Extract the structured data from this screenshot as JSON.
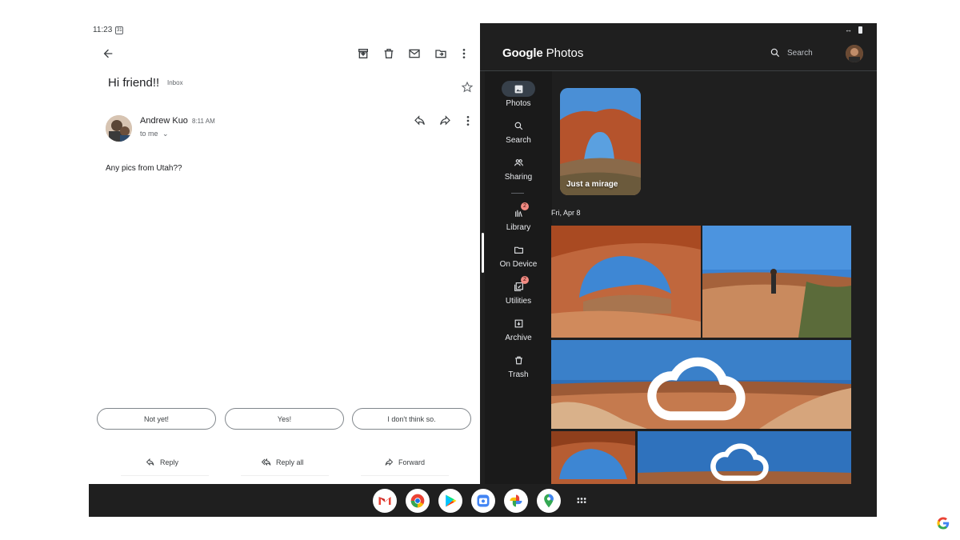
{
  "status_bar": {
    "time": "11:23"
  },
  "email": {
    "subject": "Hi friend!!",
    "label": "Inbox",
    "sender": "Andrew Kuo",
    "time": "8:11 AM",
    "recipient": "to me",
    "body": "Any pics from Utah??",
    "smart_replies": [
      "Not yet!",
      "Yes!",
      "I don't think so."
    ],
    "actions": {
      "reply": "Reply",
      "reply_all": "Reply all",
      "forward": "Forward"
    }
  },
  "photos": {
    "app_title": {
      "brand": "Google",
      "product": "Photos"
    },
    "search_label": "Search",
    "nav": [
      {
        "label": "Photos",
        "icon": "image-icon",
        "active": true
      },
      {
        "label": "Search",
        "icon": "search-icon"
      },
      {
        "label": "Sharing",
        "icon": "people-icon"
      },
      {
        "label": "Library",
        "icon": "library-icon",
        "badge": "2"
      },
      {
        "label": "On Device",
        "icon": "folder-icon"
      },
      {
        "label": "Utilities",
        "icon": "utilities-icon",
        "badge": "2"
      },
      {
        "label": "Archive",
        "icon": "archive-icon"
      },
      {
        "label": "Trash",
        "icon": "trash-icon"
      }
    ],
    "memory_title": "Just a mirage",
    "date_header": "Fri, Apr 8"
  },
  "taskbar": {
    "apps": [
      "gmail-icon",
      "chrome-icon",
      "play-store-icon",
      "camera-icon",
      "photos-icon",
      "maps-icon",
      "app-drawer-icon"
    ]
  },
  "colors": {
    "accent_blue": "#1a73e8",
    "photos_bg": "#1f1f1f",
    "nav_active": "#37404a",
    "badge": "#f28b82"
  }
}
